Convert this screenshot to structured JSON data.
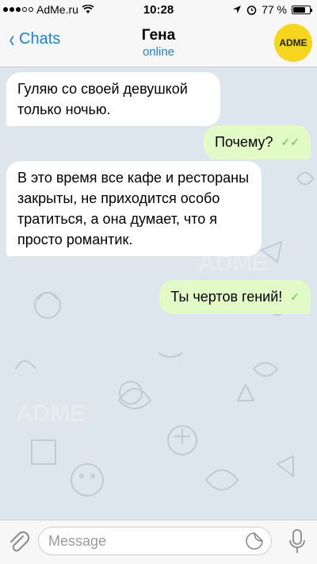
{
  "status": {
    "carrier": "AdMe.ru",
    "time": "10:28",
    "battery": "77 %",
    "battery_level": 0.77
  },
  "nav": {
    "back_label": "Chats",
    "title": "Гена",
    "subtitle": "online",
    "avatar_text": "ADME"
  },
  "messages": [
    {
      "text": "Гуляю со своей девушкой только ночью.",
      "dir": "in"
    },
    {
      "text": "Почему?",
      "dir": "out",
      "status": "read"
    },
    {
      "text": "В это время все кафе и рестораны закрыты, не приходится особо тратиться, а она думает, что я просто романтик.",
      "dir": "in"
    },
    {
      "text": "Ты чертов гений!",
      "dir": "out",
      "status": "sent"
    }
  ],
  "watermark": "ADME",
  "input": {
    "placeholder": "Message"
  },
  "colors": {
    "accent": "#1b82d8",
    "outgoing_bubble": "#e2fbc6",
    "check": "#5cc04c",
    "avatar": "#f6d51d"
  }
}
